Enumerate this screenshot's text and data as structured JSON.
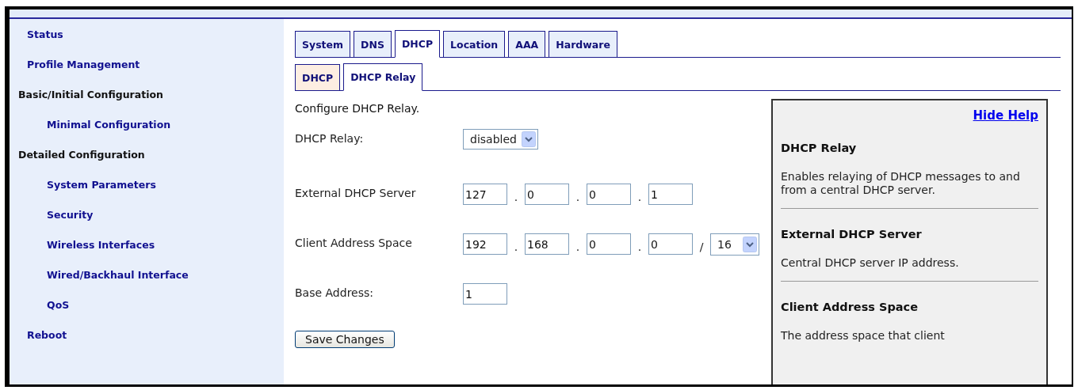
{
  "sidebar": {
    "items": [
      {
        "label": "Status",
        "kind": "link"
      },
      {
        "label": "Profile Management",
        "kind": "link"
      },
      {
        "label": "Basic/Initial Configuration",
        "kind": "section",
        "children": [
          {
            "label": "Minimal Configuration",
            "kind": "link"
          }
        ]
      },
      {
        "label": "Detailed Configuration",
        "kind": "section",
        "children": [
          {
            "label": "System Parameters",
            "kind": "link"
          },
          {
            "label": "Security",
            "kind": "link"
          },
          {
            "label": "Wireless Interfaces",
            "kind": "link"
          },
          {
            "label": "Wired/Backhaul Interface",
            "kind": "link"
          },
          {
            "label": "QoS",
            "kind": "link"
          }
        ]
      },
      {
        "label": "Reboot",
        "kind": "link"
      }
    ]
  },
  "tabs": [
    {
      "label": "System",
      "selected": false
    },
    {
      "label": "DNS",
      "selected": false
    },
    {
      "label": "DHCP",
      "selected": true
    },
    {
      "label": "Location",
      "selected": false
    },
    {
      "label": "AAA",
      "selected": false
    },
    {
      "label": "Hardware",
      "selected": false
    }
  ],
  "subtabs": [
    {
      "label": "DHCP",
      "selected": false
    },
    {
      "label": "DHCP Relay",
      "selected": true
    }
  ],
  "form": {
    "intro": "Configure DHCP Relay.",
    "rows": [
      {
        "kind": "select",
        "label": "DHCP Relay:",
        "value": "disabled"
      },
      {
        "kind": "ip",
        "label": "External DHCP Server",
        "octets": [
          "127",
          "0",
          "0",
          "1"
        ],
        "separators": [
          ".",
          ".",
          "."
        ]
      },
      {
        "kind": "ip",
        "label": "Client Address Space",
        "octets": [
          "192",
          "168",
          "0",
          "0"
        ],
        "separators": [
          ".",
          ".",
          "."
        ],
        "mask_separator": "/",
        "mask": "16"
      },
      {
        "kind": "text",
        "label": "Base Address:",
        "value": "1"
      }
    ],
    "save_button": "Save Changes"
  },
  "help": {
    "hide_link": "Hide Help",
    "sections": [
      {
        "title": "DHCP Relay",
        "text": "Enables relaying of DHCP messages to and from a central DHCP server."
      },
      {
        "title": "External DHCP Server",
        "text": "Central DHCP server IP address."
      },
      {
        "title": "Client Address Space",
        "text": "The address space that client"
      }
    ]
  }
}
